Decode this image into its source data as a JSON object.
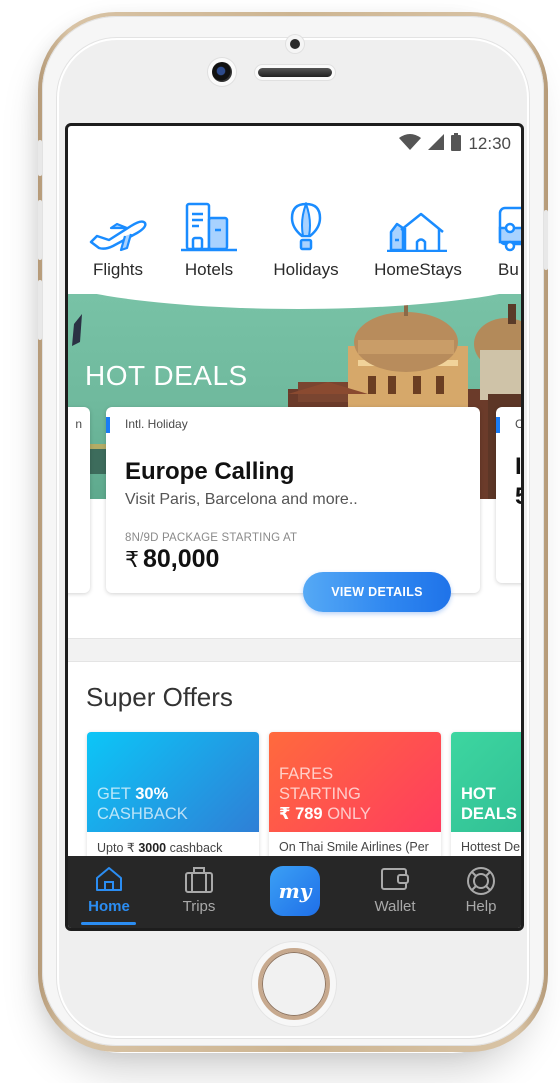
{
  "status_bar": {
    "time": "12:30",
    "icons": [
      "wifi-icon",
      "signal-icon",
      "battery-icon"
    ]
  },
  "categories": [
    {
      "label": "Flights",
      "icon": "airplane-icon"
    },
    {
      "label": "Hotels",
      "icon": "hotel-building-icon"
    },
    {
      "label": "Holidays",
      "icon": "hot-air-balloon-icon"
    },
    {
      "label": "HomeStays",
      "icon": "house-icon"
    },
    {
      "label": "Bu",
      "icon": "bus-icon"
    }
  ],
  "banner": {
    "title": "HOT DEALS"
  },
  "deals": [
    {
      "tag": "Intl. Holiday",
      "title": "Europe Calling",
      "subtitle": "Visit Paris, Barcelona and more..",
      "package_label": "8N/9D PACKAGE STARTING AT",
      "currency": "₹",
      "price": "80,000",
      "cta": "VIEW DETAILS"
    }
  ],
  "partial_cards": {
    "left_tag_fragment": "n",
    "right_tag_fragment": "C",
    "right_title_fragment": "I",
    "right_sub_fragment": "5"
  },
  "super_offers": {
    "title": "Super Offers",
    "items": [
      {
        "headline_light_1": "GET ",
        "headline_bold_1": "30%",
        "headline_light_2": "CASHBACK",
        "desc_pre": "Upto ₹ ",
        "desc_bold": "3000",
        "desc_post": " cashback",
        "gradient": [
          "#0cc6f7",
          "#2f7fd6"
        ]
      },
      {
        "headline_light_1": "FARES",
        "headline_light_2": "STARTING",
        "headline_bold_3": "₹ 789",
        "headline_light_3": " ONLY",
        "desc": "On Thai Smile Airlines (Per",
        "gradient": [
          "#ff6a3d",
          "#ff3d5e"
        ]
      },
      {
        "headline_bold_1": "HOT",
        "headline_bold_2": "DEALS",
        "desc": "Hottest De",
        "gradient": [
          "#3dd6a0",
          "#2bb38f"
        ]
      }
    ]
  },
  "bottom_nav": {
    "items": [
      {
        "label": "Home",
        "icon": "home-icon",
        "active": true
      },
      {
        "label": "Trips",
        "icon": "briefcase-icon",
        "active": false
      },
      {
        "label": "my",
        "icon": "makemytrip-logo-icon",
        "active": false
      },
      {
        "label": "Wallet",
        "icon": "wallet-icon",
        "active": false
      },
      {
        "label": "Help",
        "icon": "lifebuoy-icon",
        "active": false
      }
    ]
  },
  "colors": {
    "accent": "#1a7cf5",
    "nav_background": "#272727",
    "active_nav": "#2b8df2",
    "banner_teal": "#72bea2"
  }
}
